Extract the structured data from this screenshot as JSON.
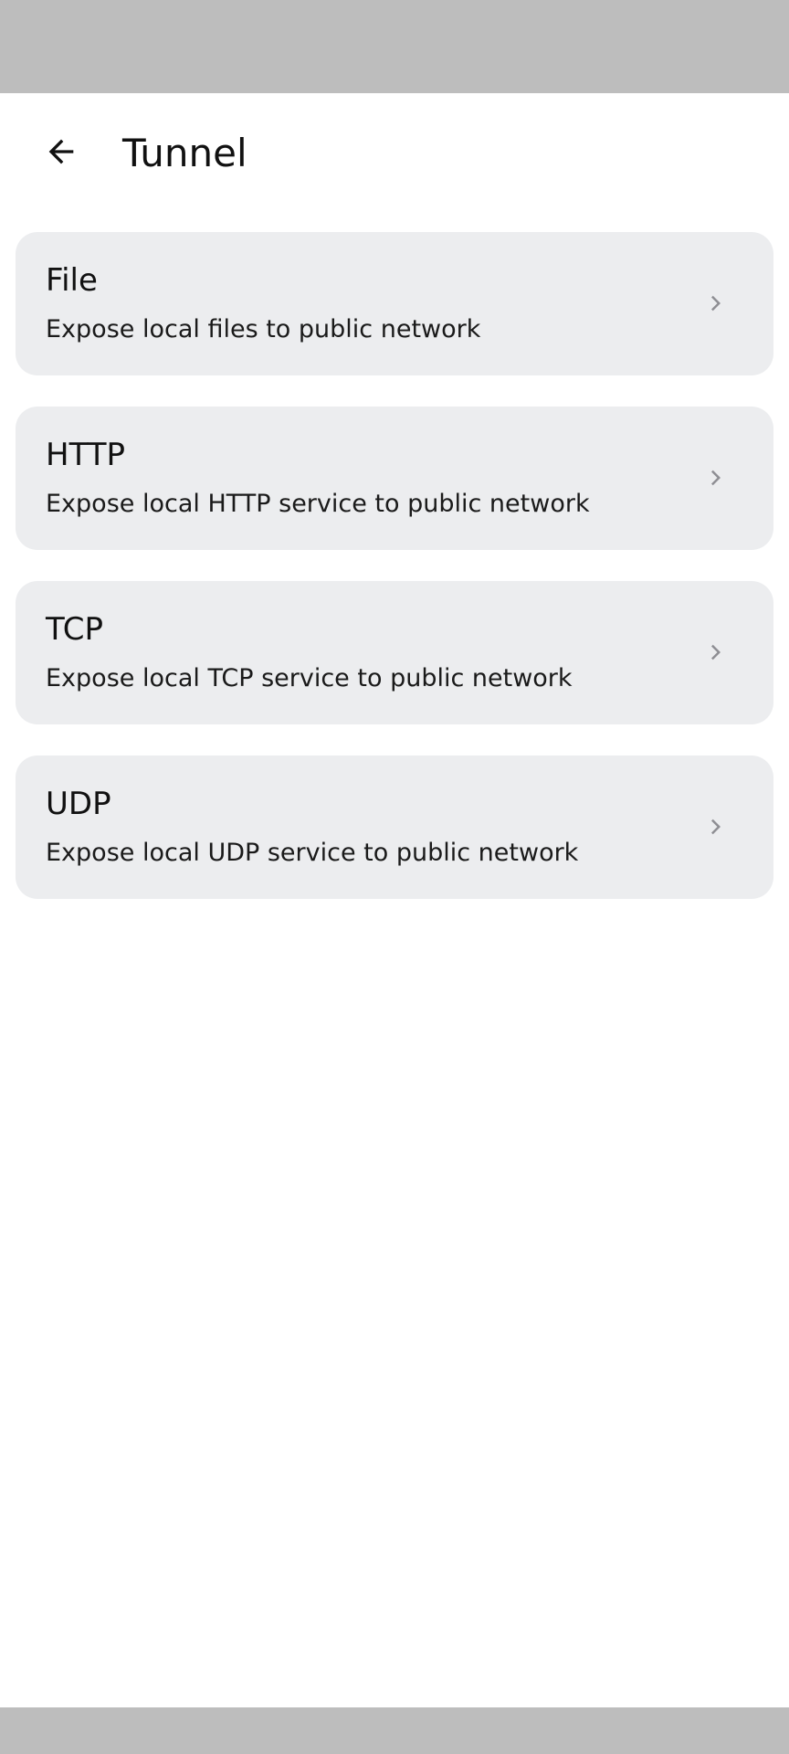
{
  "header": {
    "title": "Tunnel",
    "back_icon": "arrow-back-icon"
  },
  "colors": {
    "system_bars": "#bdbdbd",
    "card_background": "#ecedef",
    "chevron": "#8e8e93"
  },
  "items": [
    {
      "title": "File",
      "subtitle": "Expose local files to public network",
      "icon": "chevron-right-icon"
    },
    {
      "title": "HTTP",
      "subtitle": "Expose local HTTP service to public network",
      "icon": "chevron-right-icon"
    },
    {
      "title": "TCP",
      "subtitle": "Expose local TCP service to public network",
      "icon": "chevron-right-icon"
    },
    {
      "title": "UDP",
      "subtitle": "Expose local UDP service to public network",
      "icon": "chevron-right-icon"
    }
  ]
}
